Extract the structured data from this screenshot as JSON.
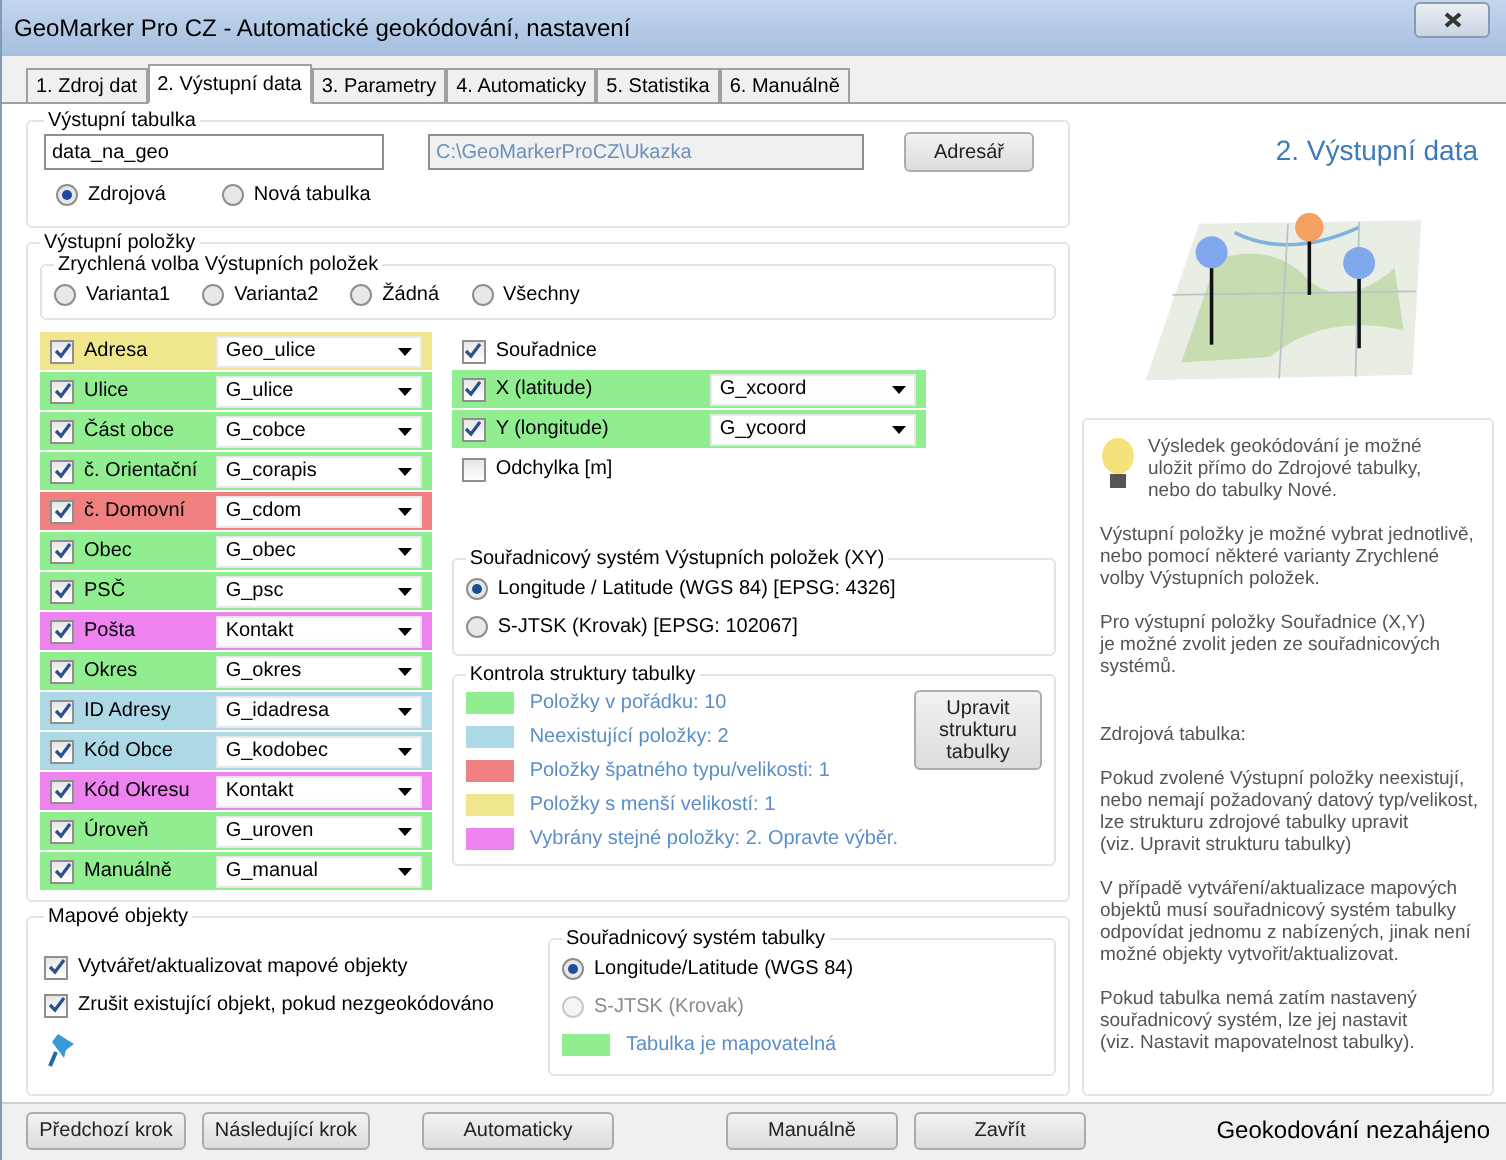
{
  "window": {
    "title": "GeoMarker Pro CZ - Automatické geokódování, nastavení"
  },
  "tabs": [
    {
      "label": "1. Zdroj dat",
      "selected": false
    },
    {
      "label": "2. Výstupní data",
      "selected": true
    },
    {
      "label": "3. Parametry",
      "selected": false
    },
    {
      "label": "4. Automaticky",
      "selected": false
    },
    {
      "label": "5. Statistika",
      "selected": false
    },
    {
      "label": "6. Manuálně",
      "selected": false
    }
  ],
  "output_table": {
    "legend": "Výstupní tabulka",
    "name_value": "data_na_geo",
    "path_value": "C:\\GeoMarkerProCZ\\Ukazka",
    "browse_button": "Adresář",
    "options": [
      {
        "label": "Zdrojová",
        "selected": true
      },
      {
        "label": "Nová tabulka",
        "selected": false
      }
    ]
  },
  "output_items": {
    "legend": "Výstupní položky",
    "quick_legend": "Zrychlená volba Výstupních položek",
    "quick_options": [
      {
        "label": "Varianta1",
        "selected": false
      },
      {
        "label": "Varianta2",
        "selected": false
      },
      {
        "label": "Žádná",
        "selected": false
      },
      {
        "label": "Všechny",
        "selected": false
      }
    ],
    "fields": [
      {
        "label": "Adresa",
        "checked": true,
        "value": "Geo_ulice",
        "color": "#f0e68c"
      },
      {
        "label": "Ulice",
        "checked": true,
        "value": "G_ulice",
        "color": "#90ee90"
      },
      {
        "label": "Část obce",
        "checked": true,
        "value": "G_cobce",
        "color": "#90ee90"
      },
      {
        "label": "č. Orientační",
        "checked": true,
        "value": "G_corapis",
        "color": "#90ee90"
      },
      {
        "label": "č. Domovní",
        "checked": true,
        "value": "G_cdom",
        "color": "#f08080"
      },
      {
        "label": "Obec",
        "checked": true,
        "value": "G_obec",
        "color": "#90ee90"
      },
      {
        "label": "PSČ",
        "checked": true,
        "value": "G_psc",
        "color": "#90ee90"
      },
      {
        "label": "Pošta",
        "checked": true,
        "value": "Kontakt",
        "color": "#ee82ee"
      },
      {
        "label": "Okres",
        "checked": true,
        "value": "G_okres",
        "color": "#90ee90"
      },
      {
        "label": "ID Adresy",
        "checked": true,
        "value": "G_idadresa",
        "color": "#add8e6"
      },
      {
        "label": "Kód Obce",
        "checked": true,
        "value": "G_kodobec",
        "color": "#add8e6"
      },
      {
        "label": "Kód Okresu",
        "checked": true,
        "value": "Kontakt",
        "color": "#ee82ee"
      },
      {
        "label": "Úroveň",
        "checked": true,
        "value": "G_uroven",
        "color": "#90ee90"
      },
      {
        "label": "Manuálně",
        "checked": true,
        "value": "G_manual",
        "color": "#90ee90"
      }
    ],
    "coordinates": {
      "label": "Souřadnice",
      "checked": true,
      "fields": [
        {
          "label": "X (latitude)",
          "checked": true,
          "value": "G_xcoord",
          "color": "#90ee90"
        },
        {
          "label": "Y (longitude)",
          "checked": true,
          "value": "G_ycoord",
          "color": "#90ee90"
        }
      ],
      "deviation": {
        "label": "Odchylka [m]",
        "checked": false
      }
    },
    "coord_system": {
      "legend": "Souřadnicový systém Výstupních položek (XY)",
      "options": [
        {
          "label": "Longitude / Latitude (WGS 84)  [EPSG: 4326]",
          "selected": true
        },
        {
          "label": "S-JTSK (Krovak)  [EPSG:  102067]",
          "selected": false
        }
      ]
    },
    "check": {
      "legend": "Kontrola struktury tabulky",
      "button": "Upravit strukturu tabulky",
      "items": [
        {
          "label": "Položky v pořádku: 10",
          "color": "#90ee90"
        },
        {
          "label": "Neexistující položky: 2",
          "color": "#add8e6"
        },
        {
          "label": "Položky špatného typu/velikosti: 1",
          "color": "#f08080"
        },
        {
          "label": "Položky s menší velikostí: 1",
          "color": "#f0e68c"
        },
        {
          "label": "Vybrány stejné položky: 2. Opravte výběr.",
          "color": "#ee82ee"
        }
      ]
    }
  },
  "map_objects": {
    "legend": "Mapové objekty",
    "options": [
      {
        "label": "Vytvářet/aktualizovat mapové objekty",
        "checked": true
      },
      {
        "label": "Zrušit existující objekt, pokud nezgeokódováno",
        "checked": true
      }
    ]
  },
  "table_system": {
    "legend": "Souřadnicový systém tabulky",
    "options": [
      {
        "label": "Longitude/Latitude (WGS 84)",
        "selected": true,
        "disabled": false
      },
      {
        "label": "S-JTSK (Krovak)",
        "selected": false,
        "disabled": true
      }
    ],
    "status": {
      "label": "Tabulka je mapovatelná",
      "color": "#90ee90"
    }
  },
  "side": {
    "title": "2. Výstupní data",
    "paragraphs": [
      [
        "Výsledek geokódování je možné",
        "uložit přímo do Zdrojové tabulky,",
        "nebo do tabulky Nové."
      ],
      [
        "Výstupní položky je možné vybrat jednotlivě,",
        "nebo pomocí některé varianty Zrychlené",
        "volby Výstupních položek."
      ],
      [
        "Pro výstupní položky Souřadnice (X,Y)",
        "je možné zvolit jeden ze souřadnicových",
        "systémů."
      ],
      [
        "Zdrojová tabulka:"
      ],
      [
        "Pokud zvolené Výstupní položky neexistují,",
        "nebo nemají požadovaný datový typ/velikost,",
        "lze strukturu zdrojové tabulky upravit",
        "(viz. Upravit strukturu tabulky)"
      ],
      [
        "V případě vytváření/aktualizace mapových",
        "objektů musí souřadnicový systém tabulky",
        "odpovídat jednomu z nabízených, jinak není",
        "možné objekty vytvořit/aktualizovat."
      ],
      [
        "Pokud tabulka nemá zatím nastavený",
        "souřadnicový systém, lze jej nastavit",
        "(viz. Nastavit mapovatelnost tabulky)."
      ]
    ]
  },
  "footer": {
    "buttons": [
      "Předchozí krok",
      "Následující krok",
      "Automaticky",
      "Manuálně",
      "Zavřít"
    ],
    "status": "Geokodování nezahájeno"
  }
}
